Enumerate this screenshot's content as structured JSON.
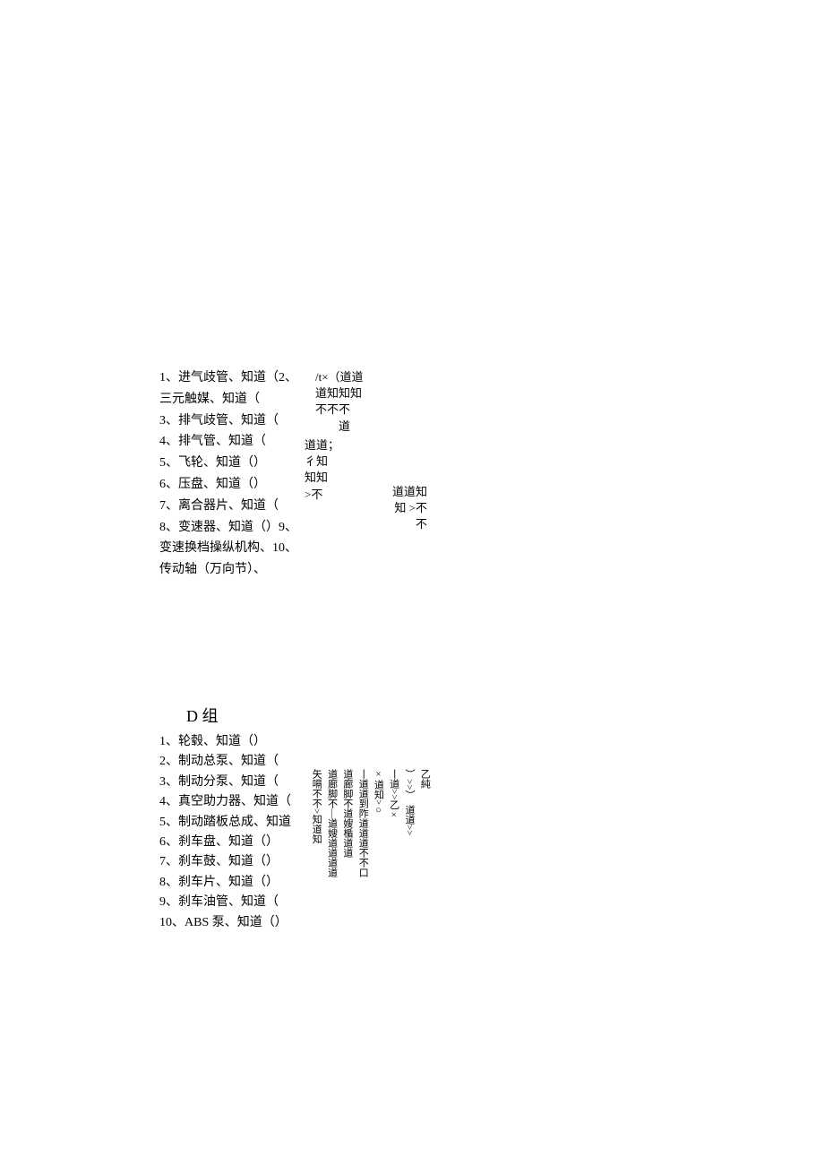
{
  "sectionC": {
    "items": [
      "1、进气歧管、知道（2、",
      "三元触媒、知道（",
      "3、排气歧管、知道（",
      "4、排气管、知道（",
      "5、飞轮、知道（）",
      "6、压盘、知道（）",
      "7、离合器片、知道（",
      "8、变速器、知道（）9、",
      "变速换档操纵机构、10、",
      "传动轴（万向节）、"
    ],
    "scatter1": [
      "/t×（道道",
      "道知知知",
      "不不不",
      "　　道"
    ],
    "scatter2": [
      "道道；",
      "彳知",
      "知知",
      ">不"
    ],
    "scatter3": [
      "道道知",
      "知 >不",
      "　　不"
    ]
  },
  "sectionD": {
    "title": "D 组",
    "items": [
      "1、轮毂、知道（）",
      "2、制动总泵、知道（",
      "3、制动分泵、知道（",
      "4、真空助力器、知道（",
      "5、制动踏板总成、知道",
      "6、刹车盘、知道（）",
      "7、刹车鼓、知道（）",
      "8、刹车片、知道（）",
      "9、刹车油管、知道（",
      "10、ABS 泵、知道（）"
    ],
    "vcols": [
      "矢嗝不不>知道知",
      "道廊脚不—道嫂道道道道",
      "道廊脚不道嫂楯道道",
      "丨道道到阼道道道不不口",
      "×道知>○",
      "丨道>>乙×",
      "）>>）　道道>>",
      "乙純"
    ]
  }
}
